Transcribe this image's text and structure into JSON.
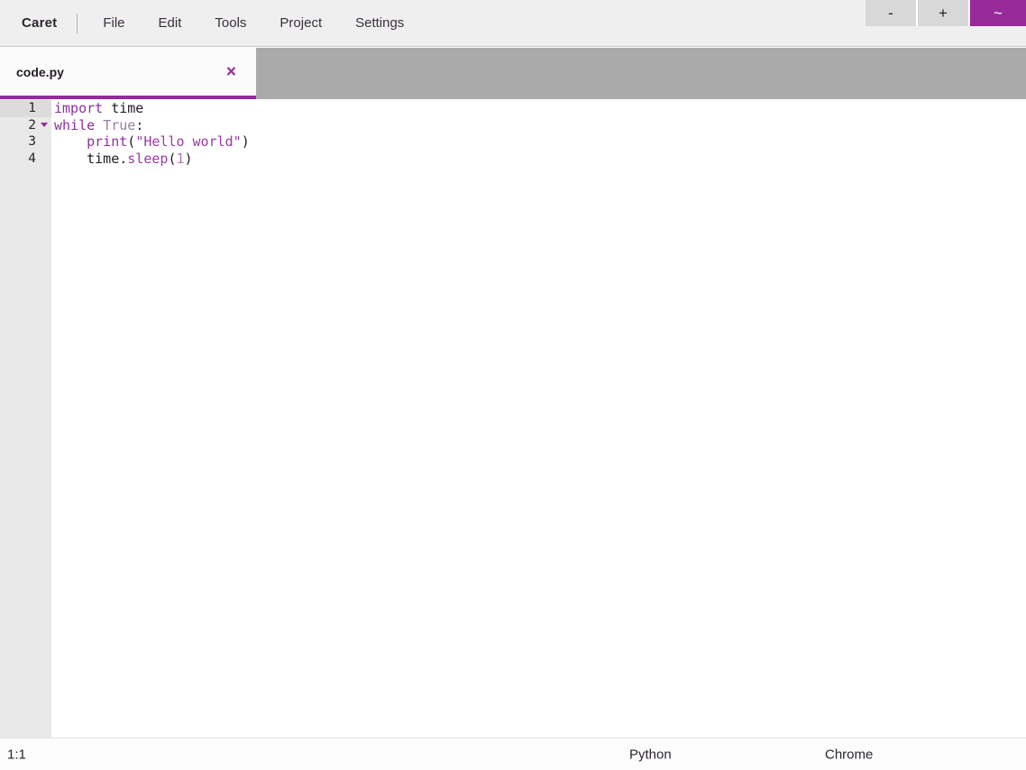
{
  "app": {
    "name": "Caret"
  },
  "menubar": {
    "items": [
      {
        "label": "File"
      },
      {
        "label": "Edit"
      },
      {
        "label": "Tools"
      },
      {
        "label": "Project"
      },
      {
        "label": "Settings"
      }
    ]
  },
  "window_controls": {
    "minimize": "-",
    "maximize": "+",
    "tilde": "~",
    "accent_color": "#962a9b"
  },
  "tabs": [
    {
      "title": "code.py",
      "close_icon": "×",
      "active": true
    }
  ],
  "editor": {
    "gutter": {
      "lines": [
        "1",
        "2",
        "3",
        "4"
      ],
      "current_line": 1,
      "fold_marker_line": 2
    },
    "lines": [
      {
        "number": "1",
        "tokens": [
          {
            "text": "import",
            "type": "kw"
          },
          {
            "text": " ",
            "type": "plain"
          },
          {
            "text": "time",
            "type": "plain"
          }
        ]
      },
      {
        "number": "2",
        "tokens": [
          {
            "text": "while",
            "type": "kw"
          },
          {
            "text": " ",
            "type": "plain"
          },
          {
            "text": "True",
            "type": "builtin"
          },
          {
            "text": ":",
            "type": "plain"
          }
        ]
      },
      {
        "number": "3",
        "tokens": [
          {
            "text": "    ",
            "type": "plain"
          },
          {
            "text": "print",
            "type": "fn"
          },
          {
            "text": "(",
            "type": "plain"
          },
          {
            "text": "\"Hello world\"",
            "type": "str"
          },
          {
            "text": ")",
            "type": "plain"
          }
        ]
      },
      {
        "number": "4",
        "tokens": [
          {
            "text": "    ",
            "type": "plain"
          },
          {
            "text": "time",
            "type": "plain"
          },
          {
            "text": ".",
            "type": "plain"
          },
          {
            "text": "sleep",
            "type": "attr"
          },
          {
            "text": "(",
            "type": "plain"
          },
          {
            "text": "1",
            "type": "num"
          },
          {
            "text": ")",
            "type": "plain"
          }
        ]
      }
    ]
  },
  "statusbar": {
    "cursor_position": "1:1",
    "language": "Python",
    "target": "Chrome"
  }
}
